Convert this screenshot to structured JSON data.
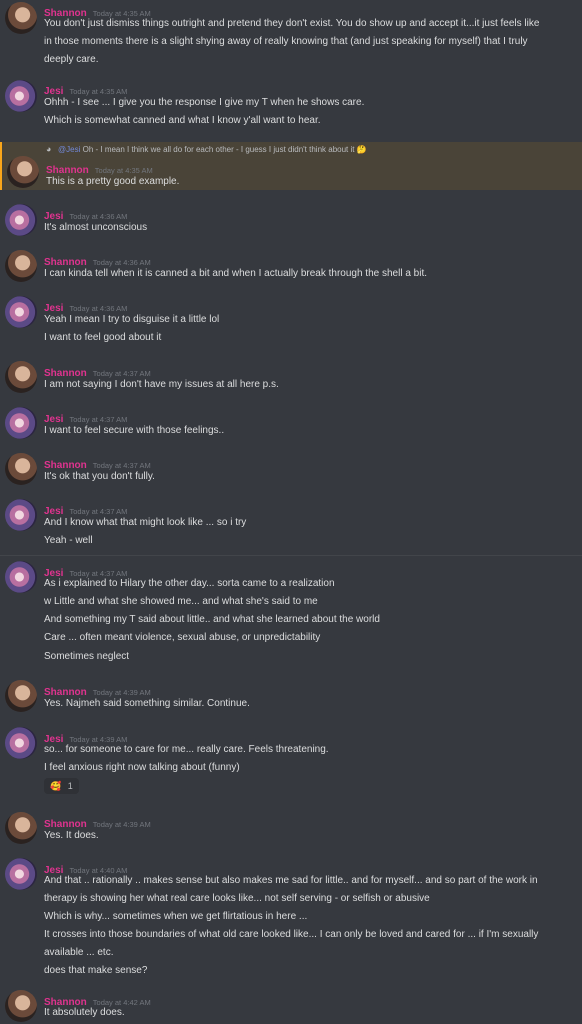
{
  "users": {
    "shannon": {
      "name": "Shannon",
      "color": "#e0338f"
    },
    "jesi": {
      "name": "Jesi",
      "color": "#e0338f"
    }
  },
  "messages": [
    {
      "user": "Shannon",
      "time": "Today at 4:35 AM",
      "lines": [
        "You don't just dismiss things outright and pretend they don't exist. You do show up and accept it...it just feels like",
        "in those moments there is a slight shying away of really knowing that (and just speaking for myself) that I truly",
        "deeply care."
      ]
    },
    {
      "user": "Jesi",
      "time": "Today at 4:35 AM",
      "lines": [
        "Ohhh -  I see ... I give you the response I give my T when he shows care.",
        "Which is somewhat canned and what I know y'all want to hear."
      ]
    },
    {
      "user": "Shannon",
      "time": "Today at 4:35 AM",
      "reply": {
        "mention": "@Jesi",
        "text": "Oh - I mean I think we all do for each other - I guess I just didn't think about it",
        "emoji": "🤔"
      },
      "lines": [
        "This is a pretty good example."
      ]
    },
    {
      "user": "Jesi",
      "time": "Today at 4:36 AM",
      "lines": [
        "It's almost unconscious"
      ]
    },
    {
      "user": "Shannon",
      "time": "Today at 4:36 AM",
      "lines": [
        "I can kinda tell when it is canned a bit and when I actually break through the shell a bit."
      ]
    },
    {
      "user": "Jesi",
      "time": "Today at 4:36 AM",
      "lines": [
        "Yeah I mean I try to disguise it a little lol",
        "I want to feel good about it"
      ]
    },
    {
      "user": "Shannon",
      "time": "Today at 4:37 AM",
      "lines": [
        "I am not saying I don't have my issues at all here p.s."
      ]
    },
    {
      "user": "Jesi",
      "time": "Today at 4:37 AM",
      "lines": [
        "I want to feel secure with those feelings.."
      ]
    },
    {
      "user": "Shannon",
      "time": "Today at 4:37 AM",
      "lines": [
        "It's ok that you don't fully."
      ]
    },
    {
      "user": "Jesi",
      "time": "Today at 4:37 AM",
      "lines": [
        "And I know what that might look like ... so i try",
        "Yeah - well"
      ]
    },
    {
      "user": "Jesi",
      "time": "Today at 4:37 AM",
      "lines": [
        "As i explained to Hilary the other day... sorta came to a realization",
        "w Little and what she showed me... and what she's said to me",
        "And something my T said about little.. and what she learned about the world",
        "Care ... often meant violence, sexual abuse, or unpredictability",
        "Sometimes neglect"
      ]
    },
    {
      "user": "Shannon",
      "time": "Today at 4:39 AM",
      "lines": [
        "Yes. Najmeh said something similar. Continue."
      ]
    },
    {
      "user": "Jesi",
      "time": "Today at 4:39 AM",
      "lines": [
        "so... for someone to care for me... really care. Feels threatening.",
        "I feel anxious right now talking about (funny)"
      ],
      "reaction": {
        "emoji": "🥰",
        "count": "1"
      }
    },
    {
      "user": "Shannon",
      "time": "Today at 4:39 AM",
      "lines": [
        "Yes. It does."
      ]
    },
    {
      "user": "Jesi",
      "time": "Today at 4:40 AM",
      "lines": [
        "And that .. rationally .. makes sense but also makes me sad for little.. and for myself... and so part of the work in",
        "therapy is showing her what real care looks like... not self serving - or selfish or abusive",
        "Which is why... sometimes when we get flirtatious in here ...",
        "It crosses into those boundaries of what old care looked like... I can only be loved and cared for ... if I'm sexually",
        "available ... etc.",
        "does that make sense?"
      ]
    },
    {
      "user": "Shannon",
      "time": "Today at 4:42 AM",
      "lines": [
        "It absolutely does."
      ]
    }
  ]
}
